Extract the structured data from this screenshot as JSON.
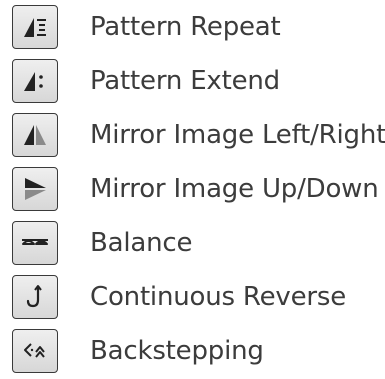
{
  "items": [
    {
      "label": "Pattern Repeat",
      "icon": "pattern-repeat-icon"
    },
    {
      "label": "Pattern Extend",
      "icon": "pattern-extend-icon"
    },
    {
      "label": "Mirror Image Left/Right",
      "icon": "mirror-left-right-icon"
    },
    {
      "label": "Mirror Image Up/Down",
      "icon": "mirror-up-down-icon"
    },
    {
      "label": "Balance",
      "icon": "balance-icon"
    },
    {
      "label": "Continuous Reverse",
      "icon": "continuous-reverse-icon"
    },
    {
      "label": "Backstepping",
      "icon": "backstepping-icon"
    }
  ],
  "colors": {
    "text": "#3c3c3c",
    "button_border": "#3a3a3a",
    "icon": "#222222",
    "icon_light": "#8a8a8a"
  }
}
